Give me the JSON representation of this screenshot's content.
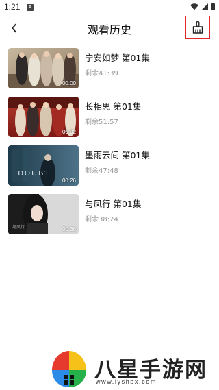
{
  "status_bar": {
    "time": "1:21",
    "badge": "A"
  },
  "header": {
    "title": "观看历史",
    "back_icon": "back-arrow-icon",
    "clear_icon": "broom-icon"
  },
  "history": [
    {
      "title": "宁安如梦 第01集",
      "remaining": "剩余41:39",
      "duration": "00:00"
    },
    {
      "title": "长相思 第01集",
      "remaining": "剩余51:57",
      "duration": "00:02"
    },
    {
      "title": "墨雨云间 第01集",
      "remaining": "剩余47:48",
      "duration": "00:26"
    },
    {
      "title": "与凤行 第01集",
      "remaining": "剩余38:24",
      "duration": "00:36"
    }
  ],
  "watermark": {
    "text": "八星手游网",
    "url": "www.lyshbx.com"
  },
  "colors": {
    "highlight_box": "#e0282d",
    "remaining_text": "#999999"
  }
}
